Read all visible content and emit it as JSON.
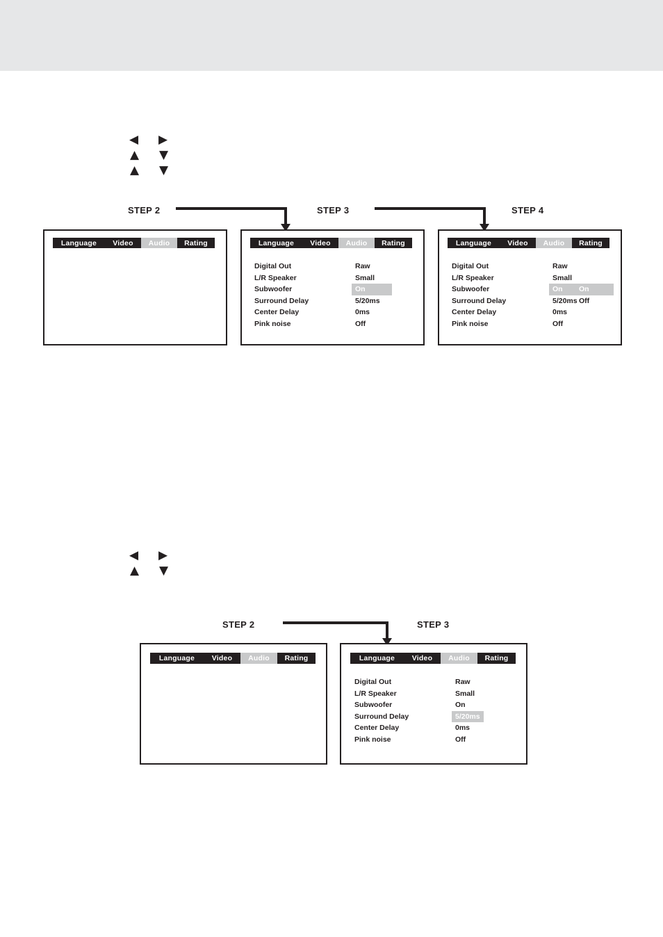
{
  "page": {
    "background_color": "#ffffff",
    "banner_color": "#e6e7e8"
  },
  "colors": {
    "ink": "#231f20",
    "menubar_bg": "#231f20",
    "highlight_bg": "#c8c9ca",
    "highlight_text": "#ffffff"
  },
  "sections": [
    {
      "id": "section-upper",
      "keys": [
        {
          "left": "◀",
          "right": "▶"
        },
        {
          "left": "▲",
          "right": "▼"
        },
        {
          "left": "▲",
          "right": "▼"
        }
      ],
      "steps": [
        {
          "label": "STEP 2"
        },
        {
          "label": "STEP 3"
        },
        {
          "label": "STEP 4"
        }
      ]
    },
    {
      "id": "section-lower",
      "keys": [
        {
          "left": "◀",
          "right": "▶"
        },
        {
          "left": "▲",
          "right": "▼"
        }
      ],
      "steps": [
        {
          "label": "STEP 2"
        },
        {
          "label": "STEP 3"
        }
      ]
    }
  ],
  "menu": {
    "tabs": [
      {
        "label": "Language",
        "active": false
      },
      {
        "label": "Video",
        "active": false
      },
      {
        "label": "Audio",
        "active": true
      },
      {
        "label": "Rating",
        "active": false
      }
    ]
  },
  "panels": {
    "upper_1": {
      "name": "audio-setup-empty-panel-step2",
      "tabs": [
        {
          "label": "Language",
          "active": false
        },
        {
          "label": "Video",
          "active": false
        },
        {
          "label": "Audio",
          "active": true
        },
        {
          "label": "Rating",
          "active": false
        }
      ],
      "rows": []
    },
    "upper_2": {
      "name": "audio-setup-panel-step3",
      "tabs": [
        {
          "label": "Language",
          "active": false
        },
        {
          "label": "Video",
          "active": false
        },
        {
          "label": "Audio",
          "active": true
        },
        {
          "label": "Rating",
          "active": false
        }
      ],
      "rows": [
        {
          "label": "Digital Out",
          "value": "Raw",
          "highlight": false
        },
        {
          "label": "L/R Speaker",
          "value": "Small",
          "highlight": false
        },
        {
          "label": "Subwoofer",
          "value": "On",
          "highlight": true
        },
        {
          "label": "Surround Delay",
          "value": "5/20ms",
          "highlight": false
        },
        {
          "label": "Center Delay",
          "value": "0ms",
          "highlight": false
        },
        {
          "label": "Pink noise",
          "value": "Off",
          "highlight": false
        }
      ]
    },
    "upper_3": {
      "name": "audio-setup-panel-step4",
      "tabs": [
        {
          "label": "Language",
          "active": false
        },
        {
          "label": "Video",
          "active": false
        },
        {
          "label": "Audio",
          "active": true
        },
        {
          "label": "Rating",
          "active": false
        }
      ],
      "rows": [
        {
          "label": "Digital Out",
          "value": "Raw",
          "highlight": false
        },
        {
          "label": "L/R Speaker",
          "value": "Small",
          "highlight": false
        },
        {
          "label": "Subwoofer",
          "value": "On",
          "highlight": true
        },
        {
          "label": "Surround Delay",
          "value": "5/20ms",
          "highlight": false
        },
        {
          "label": "Center Delay",
          "value": "0ms",
          "highlight": false
        },
        {
          "label": "Pink noise",
          "value": "Off",
          "highlight": false
        }
      ],
      "dropdown": {
        "for_row": "Subwoofer",
        "options": [
          {
            "label": "On",
            "selected": true
          },
          {
            "label": "Off",
            "selected": false
          }
        ]
      }
    },
    "lower_1": {
      "name": "audio-setup-empty-panel-step2-lower",
      "tabs": [
        {
          "label": "Language",
          "active": false
        },
        {
          "label": "Video",
          "active": false
        },
        {
          "label": "Audio",
          "active": true
        },
        {
          "label": "Rating",
          "active": false
        }
      ],
      "rows": []
    },
    "lower_2": {
      "name": "audio-setup-panel-step3-lower",
      "tabs": [
        {
          "label": "Language",
          "active": false
        },
        {
          "label": "Video",
          "active": false
        },
        {
          "label": "Audio",
          "active": true
        },
        {
          "label": "Rating",
          "active": false
        }
      ],
      "rows": [
        {
          "label": "Digital Out",
          "value": "Raw",
          "highlight": false
        },
        {
          "label": "L/R Speaker",
          "value": "Small",
          "highlight": false
        },
        {
          "label": "Subwoofer",
          "value": "On",
          "highlight": false
        },
        {
          "label": "Surround Delay",
          "value": "5/20ms",
          "highlight": true
        },
        {
          "label": "Center Delay",
          "value": "0ms",
          "highlight": false
        },
        {
          "label": "Pink noise",
          "value": "Off",
          "highlight": false
        }
      ]
    }
  }
}
